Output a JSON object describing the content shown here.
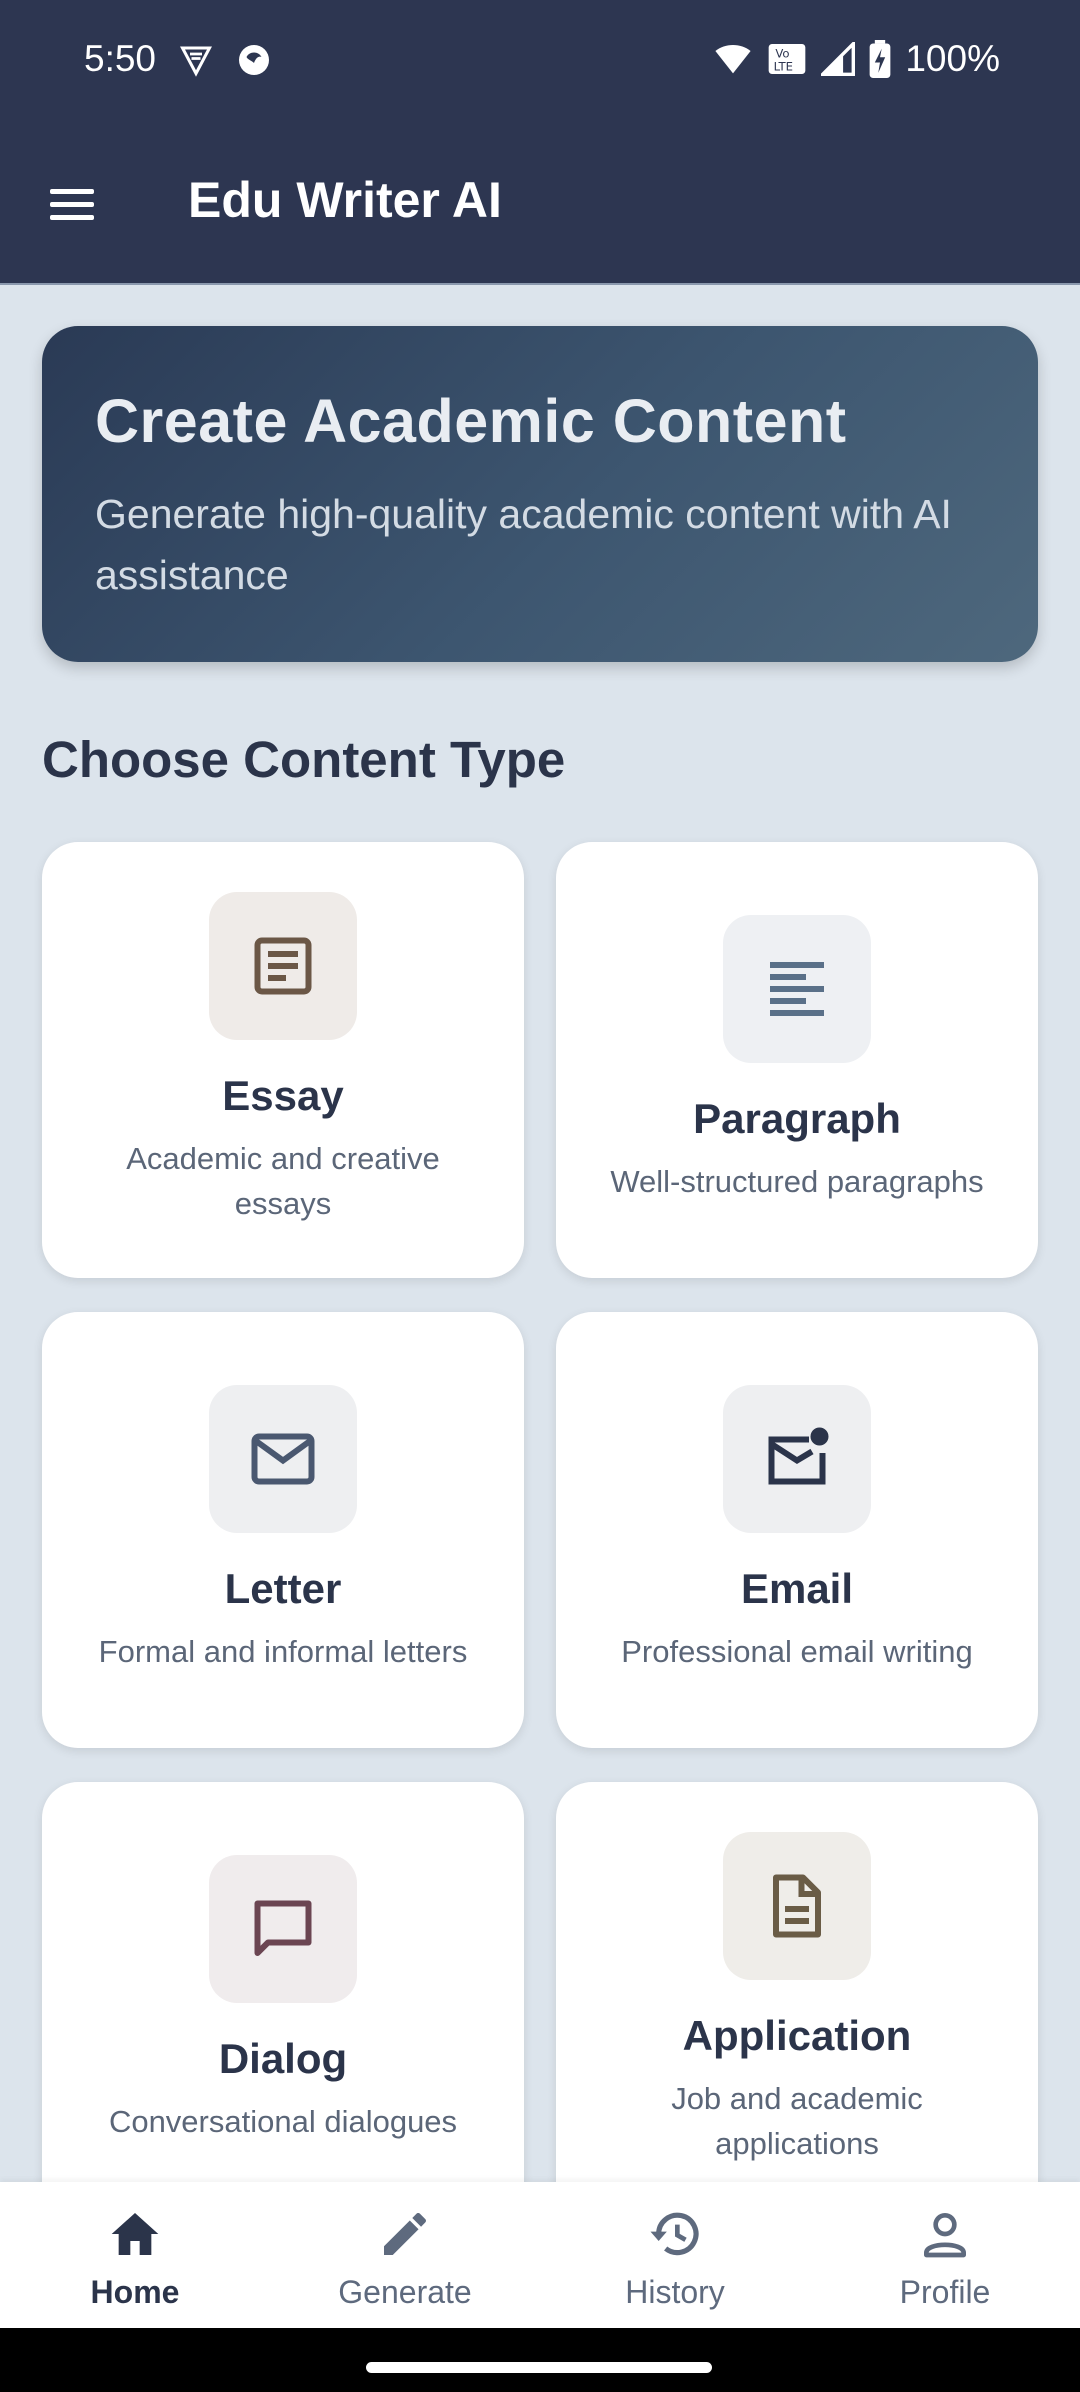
{
  "status_bar": {
    "time": "5:50",
    "battery": "100%",
    "left_icons": [
      "vpn-shield-icon",
      "app-notification-icon"
    ],
    "right_icons": [
      "wifi-icon",
      "volte-icon",
      "signal-icon",
      "battery-charging-icon"
    ]
  },
  "app_bar": {
    "title": "Edu Writer AI",
    "menu_icon": "hamburger-menu-icon"
  },
  "hero": {
    "title": "Create Academic Content",
    "subtitle": "Generate high-quality academic content with AI assistance"
  },
  "section_title": "Choose Content Type",
  "cards": [
    {
      "title": "Essay",
      "description": "Academic and creative essays",
      "icon": "article-icon",
      "icon_color": "#6b5746",
      "icon_bg": "#efebe8"
    },
    {
      "title": "Paragraph",
      "description": "Well-structured paragraphs",
      "icon": "text-lines-icon",
      "icon_color": "#5a7088",
      "icon_bg": "#eef0f3"
    },
    {
      "title": "Letter",
      "description": "Formal and informal letters",
      "icon": "mail-icon",
      "icon_color": "#4a5870",
      "icon_bg": "#eeeff1"
    },
    {
      "title": "Email",
      "description": "Professional email writing",
      "icon": "mail-unread-icon",
      "icon_color": "#2b344a",
      "icon_bg": "#eeeff1"
    },
    {
      "title": "Dialog",
      "description": "Conversational dialogues",
      "icon": "chat-bubble-icon",
      "icon_color": "#6b4552",
      "icon_bg": "#f0eced"
    },
    {
      "title": "Application",
      "description": "Job and academic applications",
      "icon": "document-icon",
      "icon_color": "#6a5c46",
      "icon_bg": "#efede9"
    }
  ],
  "bottom_nav": [
    {
      "label": "Home",
      "icon": "home-icon",
      "active": true
    },
    {
      "label": "Generate",
      "icon": "pencil-icon",
      "active": false
    },
    {
      "label": "History",
      "icon": "history-icon",
      "active": false
    },
    {
      "label": "Profile",
      "icon": "person-icon",
      "active": false
    }
  ],
  "colors": {
    "primary_dark": "#2d3651",
    "background": "#dce4ec",
    "text_dark": "#2b344a",
    "text_muted": "#5b6678"
  }
}
